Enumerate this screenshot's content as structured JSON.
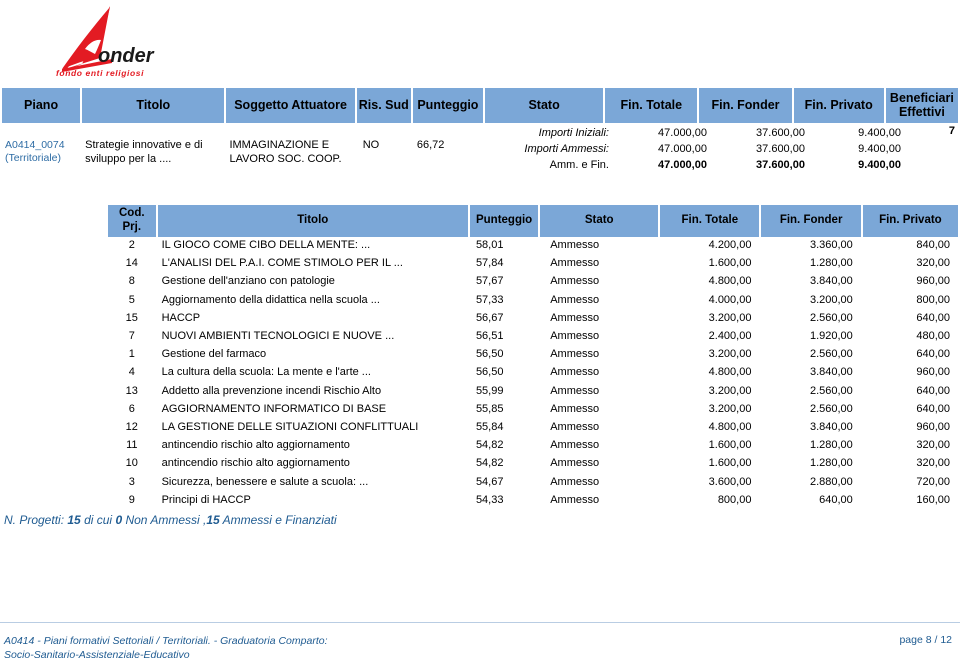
{
  "logo": {
    "name": "fonder-logo",
    "wordmark": "onder",
    "tagline": "fondo enti religiosi",
    "mark_color": "#e31b23",
    "text_color": "#1a1a1a"
  },
  "colors": {
    "header_blue": "#7ba7d7",
    "link_blue": "#2e6ca4",
    "footer_blue": "#1f5b91"
  },
  "plan_table": {
    "headers": {
      "piano": "Piano",
      "titolo": "Titolo",
      "soggetto": "Soggetto Attuatore",
      "ris_sud": "Ris. Sud",
      "punteggio": "Punteggio",
      "stato": "Stato",
      "fin_totale": "Fin. Totale",
      "fin_fonder": "Fin. Fonder",
      "fin_privato": "Fin. Privato",
      "beneficiari": "Beneficiari Effettivi"
    },
    "row": {
      "piano_code": "A0414_0074",
      "piano_type": "(Territoriale)",
      "titolo": "Strategie innovative e di sviluppo per la ....",
      "soggetto": "IMMAGINAZIONE E LAVORO SOC. COOP.",
      "ris_sud": "NO",
      "punteggio": "66,72",
      "beneficiari": "7"
    },
    "amounts": [
      {
        "label": "Importi Iniziali:",
        "totale": "47.000,00",
        "fonder": "37.600,00",
        "privato": "9.400,00",
        "bold": false
      },
      {
        "label": "Importi Ammessi:",
        "totale": "47.000,00",
        "fonder": "37.600,00",
        "privato": "9.400,00",
        "bold": false
      },
      {
        "label": "Amm. e Fin.",
        "totale": "47.000,00",
        "fonder": "37.600,00",
        "privato": "9.400,00",
        "bold": true
      }
    ]
  },
  "project_table": {
    "headers": {
      "cod_prj": "Cod. Prj.",
      "titolo": "Titolo",
      "punteggio": "Punteggio",
      "stato": "Stato",
      "fin_totale": "Fin. Totale",
      "fin_fonder": "Fin. Fonder",
      "fin_privato": "Fin. Privato"
    },
    "rows": [
      {
        "cod": "2",
        "titolo": "IL GIOCO COME CIBO DELLA MENTE: ...",
        "punteggio": "58,01",
        "stato": "Ammesso",
        "totale": "4.200,00",
        "fonder": "3.360,00",
        "privato": "840,00"
      },
      {
        "cod": "14",
        "titolo": "L'ANALISI DEL P.A.I. COME STIMOLO PER IL ...",
        "punteggio": "57,84",
        "stato": "Ammesso",
        "totale": "1.600,00",
        "fonder": "1.280,00",
        "privato": "320,00"
      },
      {
        "cod": "8",
        "titolo": "Gestione dell'anziano con patologie",
        "punteggio": "57,67",
        "stato": "Ammesso",
        "totale": "4.800,00",
        "fonder": "3.840,00",
        "privato": "960,00"
      },
      {
        "cod": "5",
        "titolo": "Aggiornamento della didattica nella scuola ...",
        "punteggio": "57,33",
        "stato": "Ammesso",
        "totale": "4.000,00",
        "fonder": "3.200,00",
        "privato": "800,00"
      },
      {
        "cod": "15",
        "titolo": "HACCP",
        "punteggio": "56,67",
        "stato": "Ammesso",
        "totale": "3.200,00",
        "fonder": "2.560,00",
        "privato": "640,00"
      },
      {
        "cod": "7",
        "titolo": "NUOVI AMBIENTI TECNOLOGICI E NUOVE ...",
        "punteggio": "56,51",
        "stato": "Ammesso",
        "totale": "2.400,00",
        "fonder": "1.920,00",
        "privato": "480,00"
      },
      {
        "cod": "1",
        "titolo": "Gestione del farmaco",
        "punteggio": "56,50",
        "stato": "Ammesso",
        "totale": "3.200,00",
        "fonder": "2.560,00",
        "privato": "640,00"
      },
      {
        "cod": "4",
        "titolo": "La cultura della scuola: La mente e l'arte ...",
        "punteggio": "56,50",
        "stato": "Ammesso",
        "totale": "4.800,00",
        "fonder": "3.840,00",
        "privato": "960,00"
      },
      {
        "cod": "13",
        "titolo": "Addetto alla prevenzione incendi Rischio Alto",
        "punteggio": "55,99",
        "stato": "Ammesso",
        "totale": "3.200,00",
        "fonder": "2.560,00",
        "privato": "640,00"
      },
      {
        "cod": "6",
        "titolo": "AGGIORNAMENTO INFORMATICO DI BASE",
        "punteggio": "55,85",
        "stato": "Ammesso",
        "totale": "3.200,00",
        "fonder": "2.560,00",
        "privato": "640,00"
      },
      {
        "cod": "12",
        "titolo": "LA GESTIONE DELLE SITUAZIONI CONFLITTUALI",
        "punteggio": "55,84",
        "stato": "Ammesso",
        "totale": "4.800,00",
        "fonder": "3.840,00",
        "privato": "960,00"
      },
      {
        "cod": "11",
        "titolo": "antincendio rischio alto aggiornamento",
        "punteggio": "54,82",
        "stato": "Ammesso",
        "totale": "1.600,00",
        "fonder": "1.280,00",
        "privato": "320,00"
      },
      {
        "cod": "10",
        "titolo": "antincendio rischio alto aggiornamento",
        "punteggio": "54,82",
        "stato": "Ammesso",
        "totale": "1.600,00",
        "fonder": "1.280,00",
        "privato": "320,00"
      },
      {
        "cod": "3",
        "titolo": "Sicurezza, benessere e salute a scuola: ...",
        "punteggio": "54,67",
        "stato": "Ammesso",
        "totale": "3.600,00",
        "fonder": "2.880,00",
        "privato": "720,00"
      },
      {
        "cod": "9",
        "titolo": "Principi di HACCP",
        "punteggio": "54,33",
        "stato": "Ammesso",
        "totale": "800,00",
        "fonder": "640,00",
        "privato": "160,00"
      }
    ]
  },
  "summary": {
    "prefix": "N. Progetti:",
    "total": "15",
    "mid1": "di cui",
    "non_ammessi_count": "0",
    "mid2": "Non Ammessi ,",
    "ammessi_count": "15",
    "suffix": "Ammessi e Finanziati"
  },
  "footer": {
    "line1": "A0414 - Piani formativi Settoriali / Territoriali. - Graduatoria Comparto:",
    "line2": "Socio-Sanitario-Assistenziale-Educativo",
    "page": "page 8 / 12"
  }
}
